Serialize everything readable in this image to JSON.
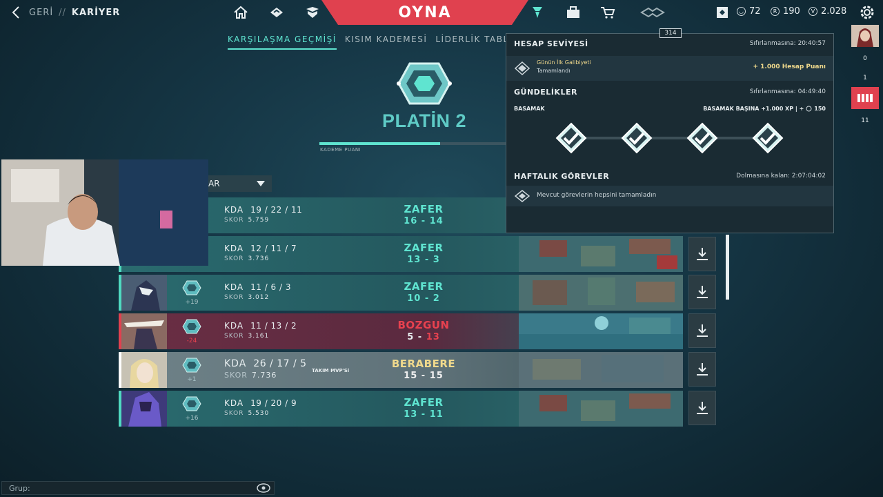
{
  "header": {
    "back_label": "GERİ",
    "separator": "//",
    "section": "KARİYER",
    "play_label": "OYNA",
    "currencies": [
      {
        "icon": "kingdom-credit-icon",
        "value": "72"
      },
      {
        "icon": "radianite-icon",
        "value": "190"
      },
      {
        "icon": "valorant-points-icon",
        "value": "2.028"
      }
    ]
  },
  "tabs": [
    {
      "label": "KARŞILAŞMA GEÇMİŞİ",
      "active": true
    },
    {
      "label": "KISIM KADEMESİ",
      "active": false
    },
    {
      "label": "LİDERLİK TABL",
      "active": false
    }
  ],
  "rank": {
    "name": "PLATİN 2",
    "progress_label": "KADEME PUANI",
    "progress_fraction": 0.64
  },
  "filter": {
    "label": "AR"
  },
  "matches": [
    {
      "outcome": "win",
      "kda_label": "KDA",
      "kda": "19 / 22 / 11",
      "skor_label": "SKOR",
      "skor": "5.759",
      "result": "ZAFER",
      "score_a": "16",
      "score_b": "14",
      "rr": ""
    },
    {
      "outcome": "win",
      "kda_label": "KDA",
      "kda": "12 / 11 / 7",
      "skor_label": "SKOR",
      "skor": "3.736",
      "result": "ZAFER",
      "score_a": "13",
      "score_b": "3",
      "rr": ""
    },
    {
      "outcome": "win",
      "kda_label": "KDA",
      "kda": "11 / 6 / 3",
      "skor_label": "SKOR",
      "skor": "3.012",
      "result": "ZAFER",
      "score_a": "10",
      "score_b": "2",
      "rr": "+19"
    },
    {
      "outcome": "loss",
      "kda_label": "KDA",
      "kda": "11 / 13 / 2",
      "skor_label": "SKOR",
      "skor": "3.161",
      "result": "BOZGUN",
      "score_a": "5",
      "score_b": "13",
      "rr": "-24"
    },
    {
      "outcome": "draw",
      "kda_label": "KDA",
      "kda": "26 / 17 / 5",
      "skor_label": "SKOR",
      "skor": "7.736",
      "result": "BERABERE",
      "score_a": "15",
      "score_b": "15",
      "rr": "+1",
      "mvp": "TAKIM MVP'Si"
    },
    {
      "outcome": "win",
      "kda_label": "KDA",
      "kda": "19 / 20 / 9",
      "skor_label": "SKOR",
      "skor": "5.530",
      "result": "ZAFER",
      "score_a": "13",
      "score_b": "11",
      "rr": "+16"
    }
  ],
  "popup": {
    "tag": "314",
    "account": {
      "title": "HESAP SEVİYESİ",
      "reset": "Sıfırlanmasına: 20:40:57",
      "item_title": "Günün İlk Galibiyeti",
      "item_status": "Tamamlandı",
      "reward": "+ 1.000 Hesap Puanı"
    },
    "daily": {
      "title": "GÜNDELİKLER",
      "reset": "Sıfırlanmasına: 04:49:40",
      "step_label": "BASAMAK",
      "step_reward": "BASAMAK BAŞINA +1.000 XP | +",
      "step_reward_amount": "150"
    },
    "weekly": {
      "title": "HAFTALIK GÖREVLER",
      "reset": "Dolmasına kalan: 2:07:04:02",
      "message": "Mevcut görevlerin hepsini tamamladın"
    }
  },
  "sidebar": {
    "counts": [
      "0",
      "1",
      "11"
    ]
  },
  "chat": {
    "label": "Grup:"
  },
  "colors": {
    "accent": "#5fe4d0",
    "play": "#e0414f",
    "loss": "#e8414f",
    "draw": "#f0d98c"
  }
}
